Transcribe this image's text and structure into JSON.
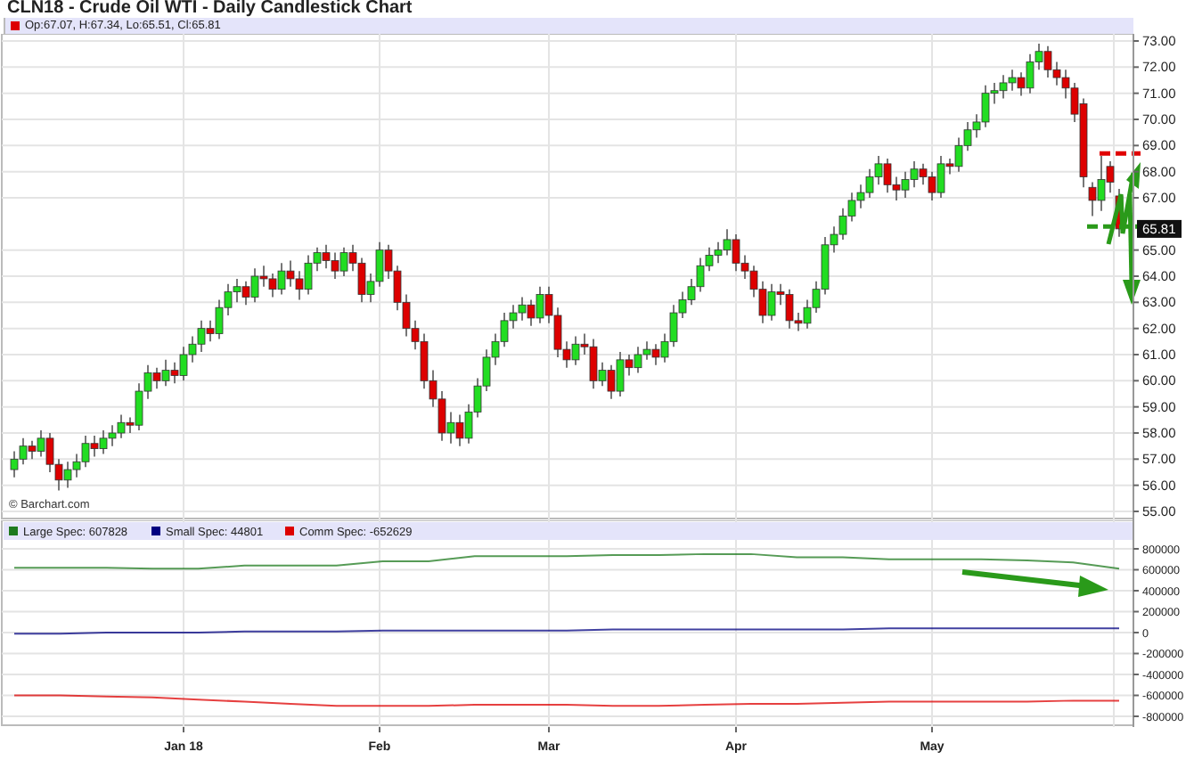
{
  "title": "CLN18 - Crude Oil WTI - Daily Candlestick Chart",
  "price_pane": {
    "legend": {
      "text": "Op:67.07, H:67.34, Lo:65.51, Cl:65.81",
      "color": "#dd0000"
    },
    "last_price": "65.81",
    "credit": "© Barchart.com",
    "chart_data": {
      "type": "candlestick",
      "ylim": [
        55,
        73
      ],
      "grid": true,
      "yticks": [
        {
          "value": 73,
          "label": "73.00"
        },
        {
          "value": 72,
          "label": "72.00"
        },
        {
          "value": 71,
          "label": "71.00"
        },
        {
          "value": 70,
          "label": "70.00"
        },
        {
          "value": 69,
          "label": "69.00"
        },
        {
          "value": 68,
          "label": "68.00"
        },
        {
          "value": 67,
          "label": "67.00"
        },
        {
          "value": 65,
          "label": "65.00"
        },
        {
          "value": 64,
          "label": "64.00"
        },
        {
          "value": 63,
          "label": "63.00"
        },
        {
          "value": 62,
          "label": "62.00"
        },
        {
          "value": 61,
          "label": "61.00"
        },
        {
          "value": 60,
          "label": "60.00"
        },
        {
          "value": 59,
          "label": "59.00"
        },
        {
          "value": 58,
          "label": "58.00"
        },
        {
          "value": 57,
          "label": "57.00"
        },
        {
          "value": 56,
          "label": "56.00"
        },
        {
          "value": 55,
          "label": "55.00"
        }
      ],
      "ohlc": [
        [
          56.6,
          57.3,
          56.3,
          57.0
        ],
        [
          57.0,
          57.8,
          56.8,
          57.5
        ],
        [
          57.5,
          57.7,
          57.0,
          57.3
        ],
        [
          57.3,
          58.1,
          57.1,
          57.8
        ],
        [
          57.8,
          58.0,
          56.5,
          56.8
        ],
        [
          56.8,
          57.0,
          55.8,
          56.2
        ],
        [
          56.2,
          56.9,
          55.9,
          56.6
        ],
        [
          56.6,
          57.2,
          56.3,
          56.9
        ],
        [
          56.9,
          57.9,
          56.7,
          57.6
        ],
        [
          57.6,
          57.9,
          57.1,
          57.4
        ],
        [
          57.4,
          58.1,
          57.2,
          57.8
        ],
        [
          57.8,
          58.3,
          57.5,
          58.0
        ],
        [
          58.0,
          58.7,
          57.8,
          58.4
        ],
        [
          58.4,
          58.6,
          58.0,
          58.3
        ],
        [
          58.3,
          59.9,
          58.1,
          59.6
        ],
        [
          59.6,
          60.6,
          59.3,
          60.3
        ],
        [
          60.3,
          60.5,
          59.7,
          60.0
        ],
        [
          60.0,
          60.8,
          59.8,
          60.4
        ],
        [
          60.4,
          60.7,
          59.9,
          60.2
        ],
        [
          60.2,
          61.3,
          60.0,
          61.0
        ],
        [
          61.0,
          61.7,
          60.7,
          61.4
        ],
        [
          61.4,
          62.3,
          61.1,
          62.0
        ],
        [
          62.0,
          62.3,
          61.5,
          61.8
        ],
        [
          61.8,
          63.1,
          61.6,
          62.8
        ],
        [
          62.8,
          63.7,
          62.5,
          63.4
        ],
        [
          63.4,
          63.9,
          63.0,
          63.6
        ],
        [
          63.6,
          63.8,
          62.9,
          63.2
        ],
        [
          63.2,
          64.3,
          63.0,
          64.0
        ],
        [
          64.0,
          64.4,
          63.6,
          63.9
        ],
        [
          63.9,
          64.1,
          63.2,
          63.5
        ],
        [
          63.5,
          64.5,
          63.3,
          64.2
        ],
        [
          64.2,
          64.6,
          63.6,
          63.9
        ],
        [
          63.9,
          64.2,
          63.1,
          63.5
        ],
        [
          63.5,
          64.8,
          63.3,
          64.5
        ],
        [
          64.5,
          65.1,
          64.2,
          64.9
        ],
        [
          64.9,
          65.2,
          64.3,
          64.6
        ],
        [
          64.6,
          64.9,
          63.9,
          64.2
        ],
        [
          64.2,
          65.1,
          64.0,
          64.9
        ],
        [
          64.9,
          65.2,
          64.2,
          64.5
        ],
        [
          64.5,
          64.7,
          63.0,
          63.3
        ],
        [
          63.3,
          64.1,
          63.0,
          63.8
        ],
        [
          63.8,
          65.3,
          63.6,
          65.0
        ],
        [
          65.0,
          65.2,
          63.9,
          64.2
        ],
        [
          64.2,
          64.4,
          62.7,
          63.0
        ],
        [
          63.0,
          63.3,
          61.7,
          62.0
        ],
        [
          62.0,
          62.3,
          61.2,
          61.5
        ],
        [
          61.5,
          61.8,
          59.7,
          60.0
        ],
        [
          60.0,
          60.4,
          59.0,
          59.3
        ],
        [
          59.3,
          59.6,
          57.7,
          58.0
        ],
        [
          58.0,
          58.8,
          57.6,
          58.4
        ],
        [
          58.4,
          58.7,
          57.5,
          57.8
        ],
        [
          57.8,
          59.1,
          57.6,
          58.8
        ],
        [
          58.8,
          60.1,
          58.6,
          59.8
        ],
        [
          59.8,
          61.2,
          59.6,
          60.9
        ],
        [
          60.9,
          61.8,
          60.6,
          61.5
        ],
        [
          61.5,
          62.6,
          61.3,
          62.3
        ],
        [
          62.3,
          62.9,
          62.0,
          62.6
        ],
        [
          62.6,
          63.2,
          62.3,
          62.9
        ],
        [
          62.9,
          63.1,
          62.1,
          62.4
        ],
        [
          62.4,
          63.6,
          62.2,
          63.3
        ],
        [
          63.3,
          63.6,
          62.2,
          62.5
        ],
        [
          62.5,
          62.8,
          60.9,
          61.2
        ],
        [
          61.2,
          61.5,
          60.5,
          60.8
        ],
        [
          60.8,
          61.7,
          60.6,
          61.4
        ],
        [
          61.4,
          61.8,
          61.0,
          61.3
        ],
        [
          61.3,
          61.6,
          59.7,
          60.0
        ],
        [
          60.0,
          60.7,
          59.8,
          60.4
        ],
        [
          60.4,
          60.6,
          59.3,
          59.6
        ],
        [
          59.6,
          61.1,
          59.4,
          60.8
        ],
        [
          60.8,
          61.0,
          60.2,
          60.5
        ],
        [
          60.5,
          61.3,
          60.3,
          61.0
        ],
        [
          61.0,
          61.5,
          60.8,
          61.2
        ],
        [
          61.2,
          61.4,
          60.6,
          60.9
        ],
        [
          60.9,
          61.8,
          60.7,
          61.5
        ],
        [
          61.5,
          62.9,
          61.3,
          62.6
        ],
        [
          62.6,
          63.4,
          62.4,
          63.1
        ],
        [
          63.1,
          63.9,
          62.9,
          63.6
        ],
        [
          63.6,
          64.7,
          63.4,
          64.4
        ],
        [
          64.4,
          65.1,
          64.2,
          64.8
        ],
        [
          64.8,
          65.3,
          64.5,
          65.0
        ],
        [
          65.0,
          65.8,
          64.8,
          65.4
        ],
        [
          65.4,
          65.6,
          64.2,
          64.5
        ],
        [
          64.5,
          64.8,
          63.9,
          64.2
        ],
        [
          64.2,
          64.4,
          63.2,
          63.5
        ],
        [
          63.5,
          63.8,
          62.2,
          62.5
        ],
        [
          62.5,
          63.7,
          62.3,
          63.4
        ],
        [
          63.4,
          63.7,
          62.9,
          63.3
        ],
        [
          63.3,
          63.5,
          62.0,
          62.3
        ],
        [
          62.3,
          62.6,
          61.9,
          62.2
        ],
        [
          62.2,
          63.1,
          62.0,
          62.8
        ],
        [
          62.8,
          63.8,
          62.6,
          63.5
        ],
        [
          63.5,
          65.5,
          63.3,
          65.2
        ],
        [
          65.2,
          65.9,
          64.9,
          65.6
        ],
        [
          65.6,
          66.6,
          65.4,
          66.3
        ],
        [
          66.3,
          67.2,
          66.1,
          66.9
        ],
        [
          66.9,
          67.5,
          66.6,
          67.2
        ],
        [
          67.2,
          68.1,
          67.0,
          67.8
        ],
        [
          67.8,
          68.6,
          67.5,
          68.3
        ],
        [
          68.3,
          68.5,
          67.2,
          67.5
        ],
        [
          67.5,
          67.8,
          66.9,
          67.3
        ],
        [
          67.3,
          68.0,
          67.0,
          67.7
        ],
        [
          67.7,
          68.4,
          67.4,
          68.1
        ],
        [
          68.1,
          68.3,
          67.5,
          67.8
        ],
        [
          67.8,
          68.0,
          66.9,
          67.2
        ],
        [
          67.2,
          68.6,
          67.0,
          68.3
        ],
        [
          68.3,
          68.5,
          67.9,
          68.2
        ],
        [
          68.2,
          69.3,
          68.0,
          69.0
        ],
        [
          69.0,
          69.9,
          68.8,
          69.6
        ],
        [
          69.6,
          70.2,
          69.3,
          69.9
        ],
        [
          69.9,
          71.3,
          69.7,
          71.0
        ],
        [
          71.0,
          71.4,
          70.6,
          71.1
        ],
        [
          71.1,
          71.7,
          70.8,
          71.4
        ],
        [
          71.4,
          71.9,
          71.1,
          71.6
        ],
        [
          71.6,
          71.8,
          70.9,
          71.2
        ],
        [
          71.2,
          72.5,
          71.0,
          72.2
        ],
        [
          72.2,
          72.9,
          71.9,
          72.6
        ],
        [
          72.6,
          72.8,
          71.6,
          71.9
        ],
        [
          71.9,
          72.2,
          71.3,
          71.6
        ],
        [
          71.6,
          71.9,
          70.8,
          71.2
        ],
        [
          71.2,
          71.4,
          69.9,
          70.2
        ],
        [
          70.6,
          70.8,
          67.4,
          67.8
        ],
        [
          67.4,
          67.6,
          66.3,
          66.9
        ],
        [
          66.9,
          68.6,
          66.5,
          67.7
        ],
        [
          68.2,
          68.4,
          67.2,
          67.6
        ],
        [
          67.07,
          67.34,
          65.51,
          65.81
        ]
      ]
    }
  },
  "cot_pane": {
    "chart_data": {
      "type": "line",
      "ylim": [
        -800000,
        800000
      ],
      "grid": true,
      "legend": true,
      "yticks": [
        {
          "value": 800000,
          "label": "800000"
        },
        {
          "value": 600000,
          "label": "600000"
        },
        {
          "value": 400000,
          "label": "400000"
        },
        {
          "value": 200000,
          "label": "200000"
        },
        {
          "value": 0,
          "label": "0"
        },
        {
          "value": -200000,
          "label": "-200000"
        },
        {
          "value": -400000,
          "label": "-400000"
        },
        {
          "value": -600000,
          "label": "-600000"
        },
        {
          "value": -800000,
          "label": "-800000"
        }
      ],
      "series": [
        {
          "name": "Large Spec: 607828",
          "color": "#1e7a1e",
          "values": [
            620000,
            620000,
            620000,
            610000,
            610000,
            640000,
            640000,
            640000,
            680000,
            680000,
            730000,
            730000,
            730000,
            740000,
            740000,
            750000,
            750000,
            720000,
            720000,
            700000,
            700000,
            700000,
            690000,
            670000,
            610000
          ]
        },
        {
          "name": "Small Spec: 44801",
          "color": "#000080",
          "values": [
            -10000,
            -10000,
            0,
            0,
            0,
            10000,
            10000,
            10000,
            20000,
            20000,
            20000,
            20000,
            20000,
            30000,
            30000,
            30000,
            30000,
            30000,
            30000,
            40000,
            40000,
            40000,
            40000,
            40000,
            40000
          ]
        },
        {
          "name": "Comm Spec: -652629",
          "color": "#dd0000",
          "values": [
            -600000,
            -600000,
            -610000,
            -620000,
            -640000,
            -660000,
            -680000,
            -700000,
            -700000,
            -700000,
            -690000,
            -690000,
            -690000,
            -700000,
            -700000,
            -690000,
            -680000,
            -680000,
            -670000,
            -660000,
            -660000,
            -660000,
            -660000,
            -650000,
            -650000
          ]
        }
      ]
    }
  },
  "x_axis_labels": [
    "Jan 18",
    "Feb",
    "Mar",
    "Apr",
    "May"
  ]
}
